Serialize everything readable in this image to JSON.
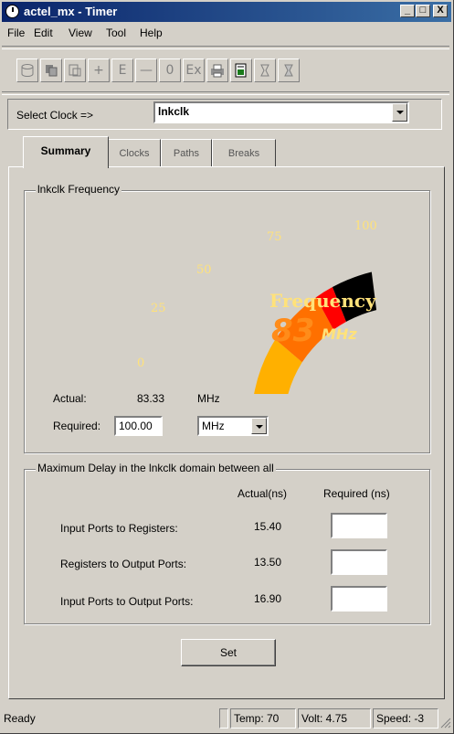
{
  "window": {
    "title": "actel_mx - Timer",
    "min": "_",
    "max": "□",
    "close": "X"
  },
  "menu": [
    "File",
    "Edit",
    "View",
    "Tool",
    "Help"
  ],
  "toolbar": {
    "icons": [
      "database-icon",
      "copy-icon",
      "paste-icon",
      "plus-icon",
      "e-icon",
      "minus-icon",
      "zero-icon",
      "ex-icon",
      "print-icon",
      "report-icon",
      "hourglass-icon",
      "hourglass-alt-icon"
    ],
    "labels": [
      "",
      "",
      "",
      "+",
      "E",
      "—",
      "0",
      "Ex",
      "",
      "",
      "",
      ""
    ]
  },
  "clock": {
    "label": "Select Clock =>",
    "value": "lnkclk"
  },
  "tabs": [
    "Summary",
    "Clocks",
    "Paths",
    "Breaks"
  ],
  "frequency": {
    "group_title": "lnkclk Frequency",
    "gauge": {
      "min": 0,
      "max": 100,
      "ticks": [
        "0",
        "25",
        "50",
        "75",
        "100"
      ],
      "value": 83,
      "bands": [
        {
          "from": 0,
          "to": 50,
          "color": "#ffb000"
        },
        {
          "from": 50,
          "to": 75,
          "color": "#ff7000"
        },
        {
          "from": 75,
          "to": 83,
          "color": "#ff0000"
        },
        {
          "from": 83,
          "to": 100,
          "color": "#000000"
        }
      ]
    },
    "caption": "Frequency",
    "readout_value": "83",
    "readout_unit": "MHz",
    "actual_label": "Actual:",
    "actual_value": "83.33",
    "actual_unit": "MHz",
    "required_label": "Required:",
    "required_value": "100.00",
    "required_unit": "MHz"
  },
  "delay": {
    "group_title": "Maximum Delay in the lnkclk domain between all",
    "col_actual": "Actual(ns)",
    "col_required": "Required (ns)",
    "rows": [
      {
        "label": "Input Ports to Registers:",
        "actual": "15.40",
        "required": ""
      },
      {
        "label": "Registers to Output Ports:",
        "actual": "13.50",
        "required": ""
      },
      {
        "label": "Input Ports to Output Ports:",
        "actual": "16.90",
        "required": ""
      }
    ]
  },
  "set_button": "Set",
  "status": {
    "ready": "Ready",
    "temp": "Temp: 70",
    "volt": "Volt: 4.75",
    "speed": "Speed: -3"
  }
}
